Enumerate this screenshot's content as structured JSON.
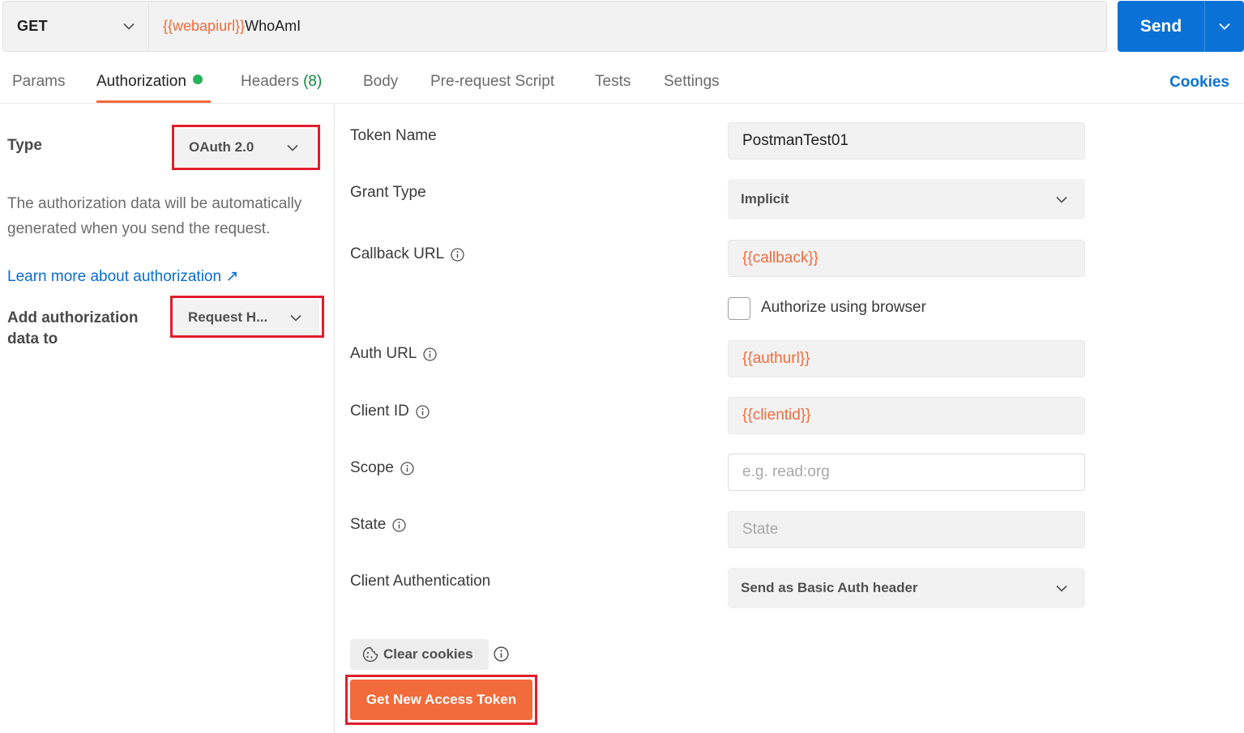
{
  "request": {
    "method": "GET",
    "url_variable": "{{webapiurl}}",
    "url_path": "WhoAmI",
    "send_label": "Send"
  },
  "tabs": [
    {
      "label": "Params"
    },
    {
      "label": "Authorization"
    },
    {
      "label": "Headers",
      "count": "(8)"
    },
    {
      "label": "Body"
    },
    {
      "label": "Pre-request Script"
    },
    {
      "label": "Tests"
    },
    {
      "label": "Settings"
    }
  ],
  "active_tab": "Authorization",
  "cookies_label": "Cookies",
  "auth": {
    "type_label": "Type",
    "type_value": "OAuth 2.0",
    "description": "The authorization data will be automatically generated when you send the request.",
    "learn_more": "Learn more about authorization ↗",
    "add_to_label": "Add authorization data to",
    "add_to_value": "Request H..."
  },
  "form": {
    "token_name": {
      "label": "Token Name",
      "value": "PostmanTest01"
    },
    "grant_type": {
      "label": "Grant Type",
      "value": "Implicit"
    },
    "callback_url": {
      "label": "Callback URL",
      "value": "{{callback}}"
    },
    "authorize_browser": {
      "label": "Authorize using browser",
      "checked": false
    },
    "auth_url": {
      "label": "Auth URL",
      "value": "{{authurl}}"
    },
    "client_id": {
      "label": "Client ID",
      "value": "{{clientid}}"
    },
    "scope": {
      "label": "Scope",
      "placeholder": "e.g. read:org"
    },
    "state": {
      "label": "State",
      "placeholder": "State"
    },
    "client_auth": {
      "label": "Client Authentication",
      "value": "Send as Basic Auth header"
    }
  },
  "buttons": {
    "clear_cookies": "Clear cookies",
    "get_token": "Get New Access Token"
  },
  "colors": {
    "accent_orange": "#f26b3a",
    "send_blue": "#0a72d6",
    "highlight_red": "#e01e2c",
    "status_green": "#26b35a"
  }
}
